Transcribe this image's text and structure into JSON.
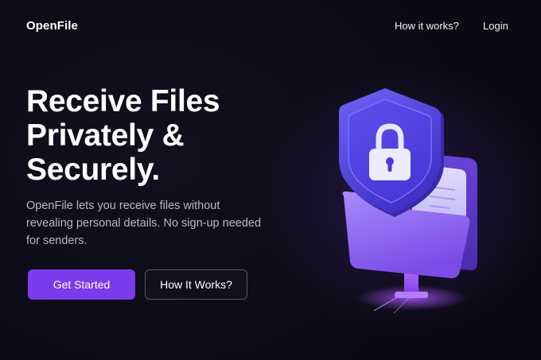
{
  "brand": {
    "name": "OpenFile"
  },
  "nav": {
    "links": [
      {
        "label": "How it works?"
      },
      {
        "label": "Login"
      }
    ]
  },
  "hero": {
    "title_lines": [
      "Receive Files",
      "Privately &",
      "Securely."
    ],
    "description": "OpenFile lets you receive files without revealing personal details. No sign-up needed for senders.",
    "primary_button": "Get Started",
    "secondary_button": "How It Works?"
  },
  "illustration": {
    "icons": [
      "shield-lock-icon",
      "folder-icon",
      "document-icon"
    ]
  },
  "colors": {
    "background": "#0b0a14",
    "accent": "#7c3aed",
    "shield": "#5b4ee6",
    "folder": "#8b5cf6",
    "text_muted": "#b8b6c8"
  }
}
